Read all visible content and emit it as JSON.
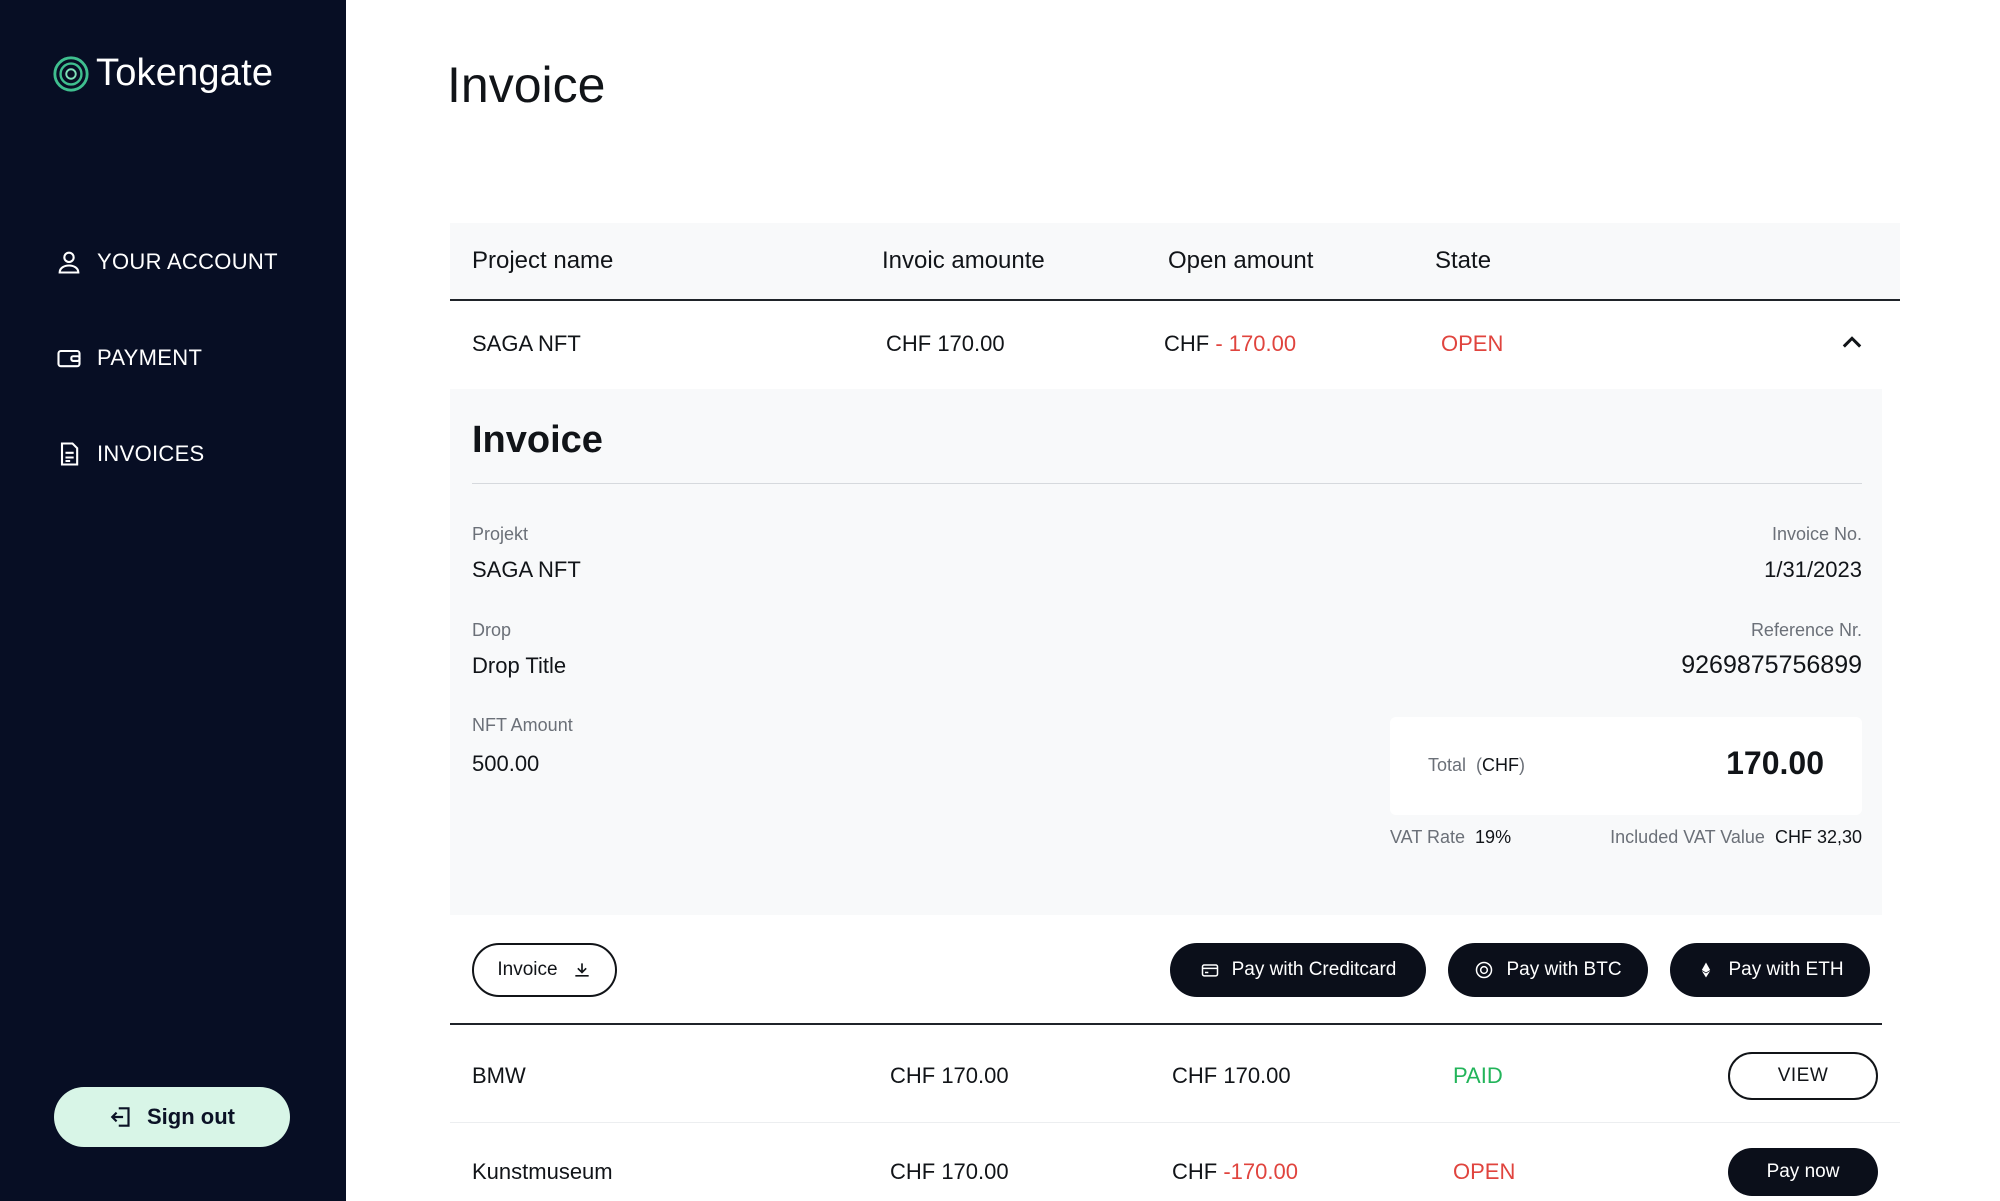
{
  "brand": {
    "name": "Tokengate",
    "accent": "#3fbf8f",
    "sidebar_bg": "#070e24"
  },
  "sidebar": {
    "items": [
      {
        "label": "YOUR ACCOUNT",
        "icon": "user-icon"
      },
      {
        "label": "PAYMENT",
        "icon": "wallet-icon"
      },
      {
        "label": "INVOICES",
        "icon": "document-icon"
      }
    ],
    "signout_label": "Sign out"
  },
  "page": {
    "title": "Invoice"
  },
  "table": {
    "headers": [
      "Project name",
      "Invoic amounte",
      "Open amount",
      "State"
    ],
    "rows": [
      {
        "project": "SAGA NFT",
        "invoice_amount": "CHF 170.00",
        "open_prefix": "CHF",
        "open_value": "- 170.00",
        "state": "OPEN",
        "expanded": true
      },
      {
        "project": "BMW",
        "invoice_amount": "CHF 170.00",
        "open_prefix": "CHF",
        "open_value": "170.00",
        "state": "PAID",
        "action": "VIEW"
      },
      {
        "project": "Kunstmuseum",
        "invoice_amount": "CHF 170.00",
        "open_prefix": "CHF",
        "open_value": "-170.00",
        "state": "OPEN",
        "action": "Pay now"
      }
    ]
  },
  "detail": {
    "title": "Invoice",
    "projekt_label": "Projekt",
    "projekt_value": "SAGA NFT",
    "drop_label": "Drop",
    "drop_value": "Drop Title",
    "nft_amount_label": "NFT Amount",
    "nft_amount_value": "500.00",
    "invoice_no_label": "Invoice No.",
    "invoice_no_value": "1/31/2023",
    "reference_label": "Reference Nr.",
    "reference_value": "9269875756899",
    "total_label": "Total",
    "total_currency": "CHF",
    "total_value": "170.00",
    "vat_rate_label": "VAT Rate",
    "vat_rate_value": "19%",
    "vat_included_label": "Included VAT Value",
    "vat_included_value": "CHF 32,30"
  },
  "actions": {
    "invoice_download": "Invoice",
    "pay_card": "Pay with Creditcard",
    "pay_btc": "Pay with BTC",
    "pay_eth": "Pay with ETH"
  },
  "colors": {
    "open": "#e0443e",
    "paid": "#22b45a",
    "signout_bg": "#d8f5e7"
  }
}
